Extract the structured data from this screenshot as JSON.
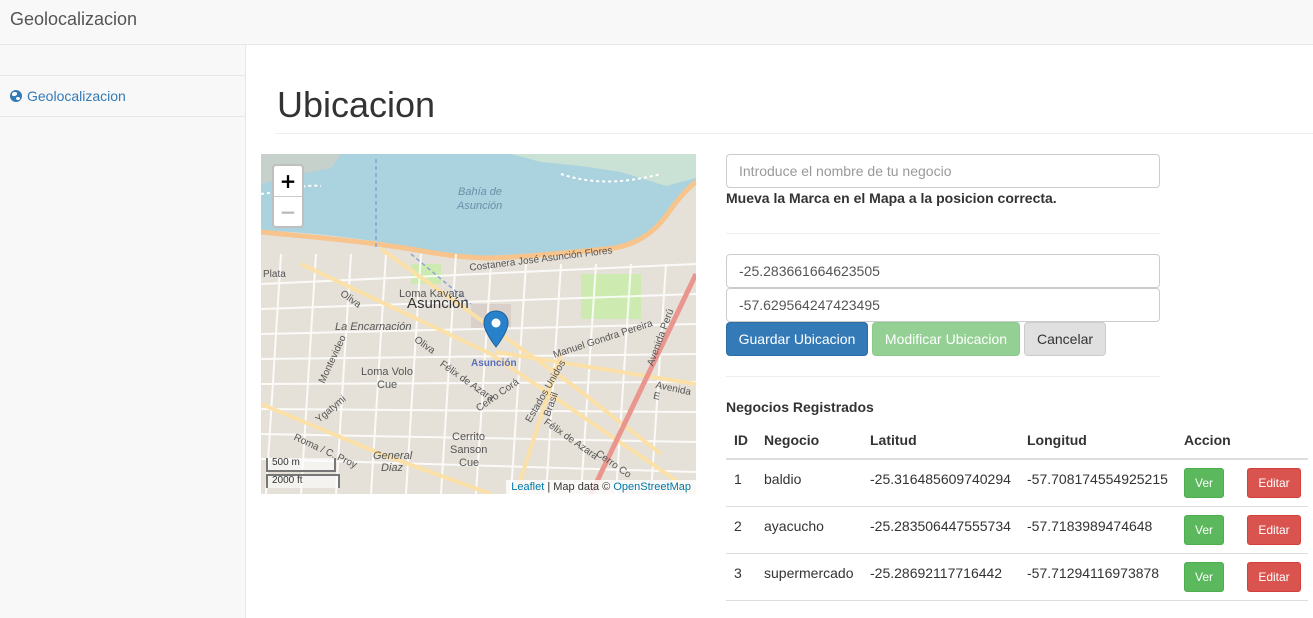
{
  "navbar": {
    "brand": "Geolocalizacion"
  },
  "sidebar": {
    "items": [
      {
        "label": "Geolocalizacion",
        "icon": "globe-icon"
      }
    ]
  },
  "main": {
    "title": "Ubicacion"
  },
  "map": {
    "zoom_in": "+",
    "zoom_out": "−",
    "scale_metric": "500 m",
    "scale_imperial": "2000 ft",
    "attribution_leaflet": "Leaflet",
    "attribution_text": " | Map data © ",
    "attribution_osm": "OpenStreetMap",
    "labels": {
      "bay": "Bahía de",
      "bay2": "Asunción",
      "city": "Asunción",
      "marker": "Asunción",
      "costanera": "Costanera José Asunción Flores",
      "loma_kavara": "Loma Kavara",
      "encarnacion": "La Encarnación",
      "loma_volo": "Loma Volo",
      "cue": "Cue",
      "cerrito": "Cerrito",
      "sanson": "Sanson",
      "cue2": "Cue",
      "general": "General",
      "diaz": "Diaz",
      "olivia": "Oliva",
      "olivia2": "Oliva",
      "montevideo": "Montevideo",
      "ygatymi": "Ygatymi",
      "felix": "Félix de Azara",
      "felix2": "Félix de Azara",
      "cerro_cora": "Cerro Corá",
      "cerro_cora2": "Cerro Co",
      "estados": "Estados Unidos",
      "brasil": "Brasil",
      "gondra": "Manuel Gondra Pereira",
      "avenida_peru": "Avenida Perú",
      "avenida_e": "Avenida E",
      "plata": "Plata",
      "roma": "Roma / C. Proy"
    }
  },
  "form": {
    "name_placeholder": "Introduce el nombre de tu negocio",
    "help_text": "Mueva la Marca en el Mapa a la posicion correcta.",
    "latitude_value": "-25.283661664623505",
    "longitude_value": "-57.629564247423495",
    "save_label": "Guardar Ubicacion",
    "modify_label": "Modificar Ubicacion",
    "cancel_label": "Cancelar"
  },
  "table": {
    "title": "Negocios Registrados",
    "headers": [
      "ID",
      "Negocio",
      "Latitud",
      "Longitud",
      "Accion"
    ],
    "rows": [
      {
        "id": "1",
        "name": "baldio",
        "lat": "-25.316485609740294",
        "lng": "-57.708174554925215",
        "view": "Ver",
        "edit": "Editar"
      },
      {
        "id": "2",
        "name": "ayacucho",
        "lat": "-25.283506447555734",
        "lng": "-57.7183989474648",
        "view": "Ver",
        "edit": "Editar"
      },
      {
        "id": "3",
        "name": "supermercado",
        "lat": "-25.28692117716442",
        "lng": "-57.71294116973878",
        "view": "Ver",
        "edit": "Editar"
      }
    ]
  },
  "colors": {
    "primary": "#337ab7",
    "success": "#5cb85c",
    "danger": "#d9534f",
    "water": "#aad3df",
    "marker": "#2a81cb"
  }
}
